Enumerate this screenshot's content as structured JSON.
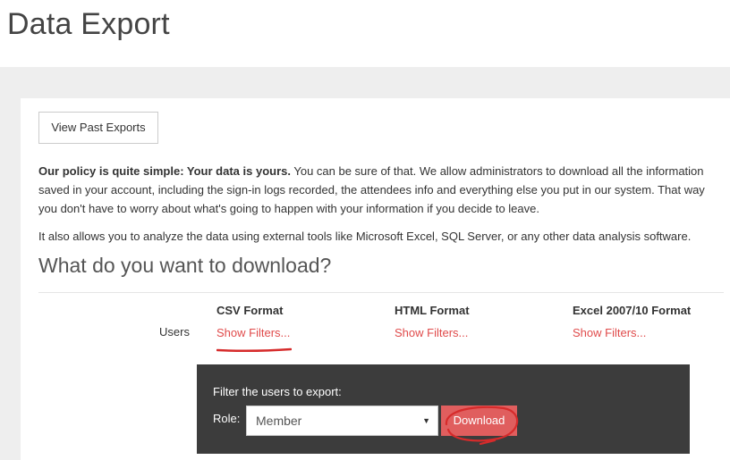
{
  "page": {
    "title": "Data Export"
  },
  "toolbar": {
    "past_exports_label": "View Past Exports"
  },
  "policy": {
    "bold_text": "Our policy is quite simple: Your data is yours.",
    "body_text": " You can be sure of that. We allow administrators to download all the information saved in your account, including the sign-in logs recorded, the attendees info and everything else you put in our system. That way you don't have to worry about what's going to happen with your information if you decide to leave.",
    "analyze_text": "It also allows you to analyze the data using external tools like Microsoft Excel, SQL Server, or any other data analysis software."
  },
  "download_section": {
    "title": "What do you want to download?",
    "row_label": "Users",
    "formats": [
      {
        "name": "CSV Format",
        "link": "Show Filters..."
      },
      {
        "name": "HTML Format",
        "link": "Show Filters..."
      },
      {
        "name": "Excel 2007/10 Format",
        "link": "Show Filters..."
      }
    ]
  },
  "filter_panel": {
    "caption": "Filter the users to export:",
    "role_label": "Role:",
    "role_value": "Member",
    "download_label": "Download"
  },
  "colors": {
    "accent_red": "#e04b4b",
    "download_bg": "#e05e5e",
    "panel_bg": "#3c3c3c",
    "gray_area": "#eeeeee"
  },
  "icons": {
    "select_arrow": "chevron-down-icon"
  }
}
